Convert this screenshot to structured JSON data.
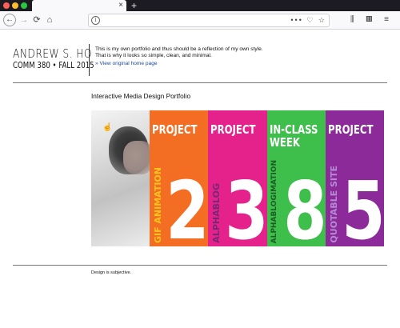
{
  "browser": {
    "new_tab_symbol": "+",
    "tab_close_symbol": "×",
    "nav": {
      "back_icon": "←",
      "forward_icon": "→",
      "reload_icon": "⟳",
      "home_icon": "⌂"
    },
    "url_info_symbol": "i",
    "url_actions": "••• ♡ ☆",
    "toolbar_icons": "⫼ ▥ ≡"
  },
  "header": {
    "author": "ANDREW S. HO",
    "course": "COMM 380 • FALL 2015",
    "tagline": "This is my own portfolio and thus should be a reflection of my own style. That is why it looks so simple, clean, and minimal.",
    "home_link": "» View original home page"
  },
  "section_title": "Interactive Media Design Portfolio",
  "banner": {
    "cursor_icon": "☝",
    "projects": [
      {
        "title": "PROJECT",
        "number": "2",
        "name": "GIF ANIMATION",
        "color": "#f36e22"
      },
      {
        "title": "PROJECT",
        "number": "3",
        "name": "ALPHABLOG",
        "color": "#e5228b"
      },
      {
        "title": "IN-CLASS WEEK",
        "number": "8",
        "name": "ALPHABLOGIMATION",
        "color": "#3ebe4a"
      },
      {
        "title": "PROJECT",
        "number": "5",
        "name": "QUOTABLE SITE",
        "color": "#8c2a9a"
      }
    ]
  },
  "footer": {
    "text": "Design is subjective."
  }
}
